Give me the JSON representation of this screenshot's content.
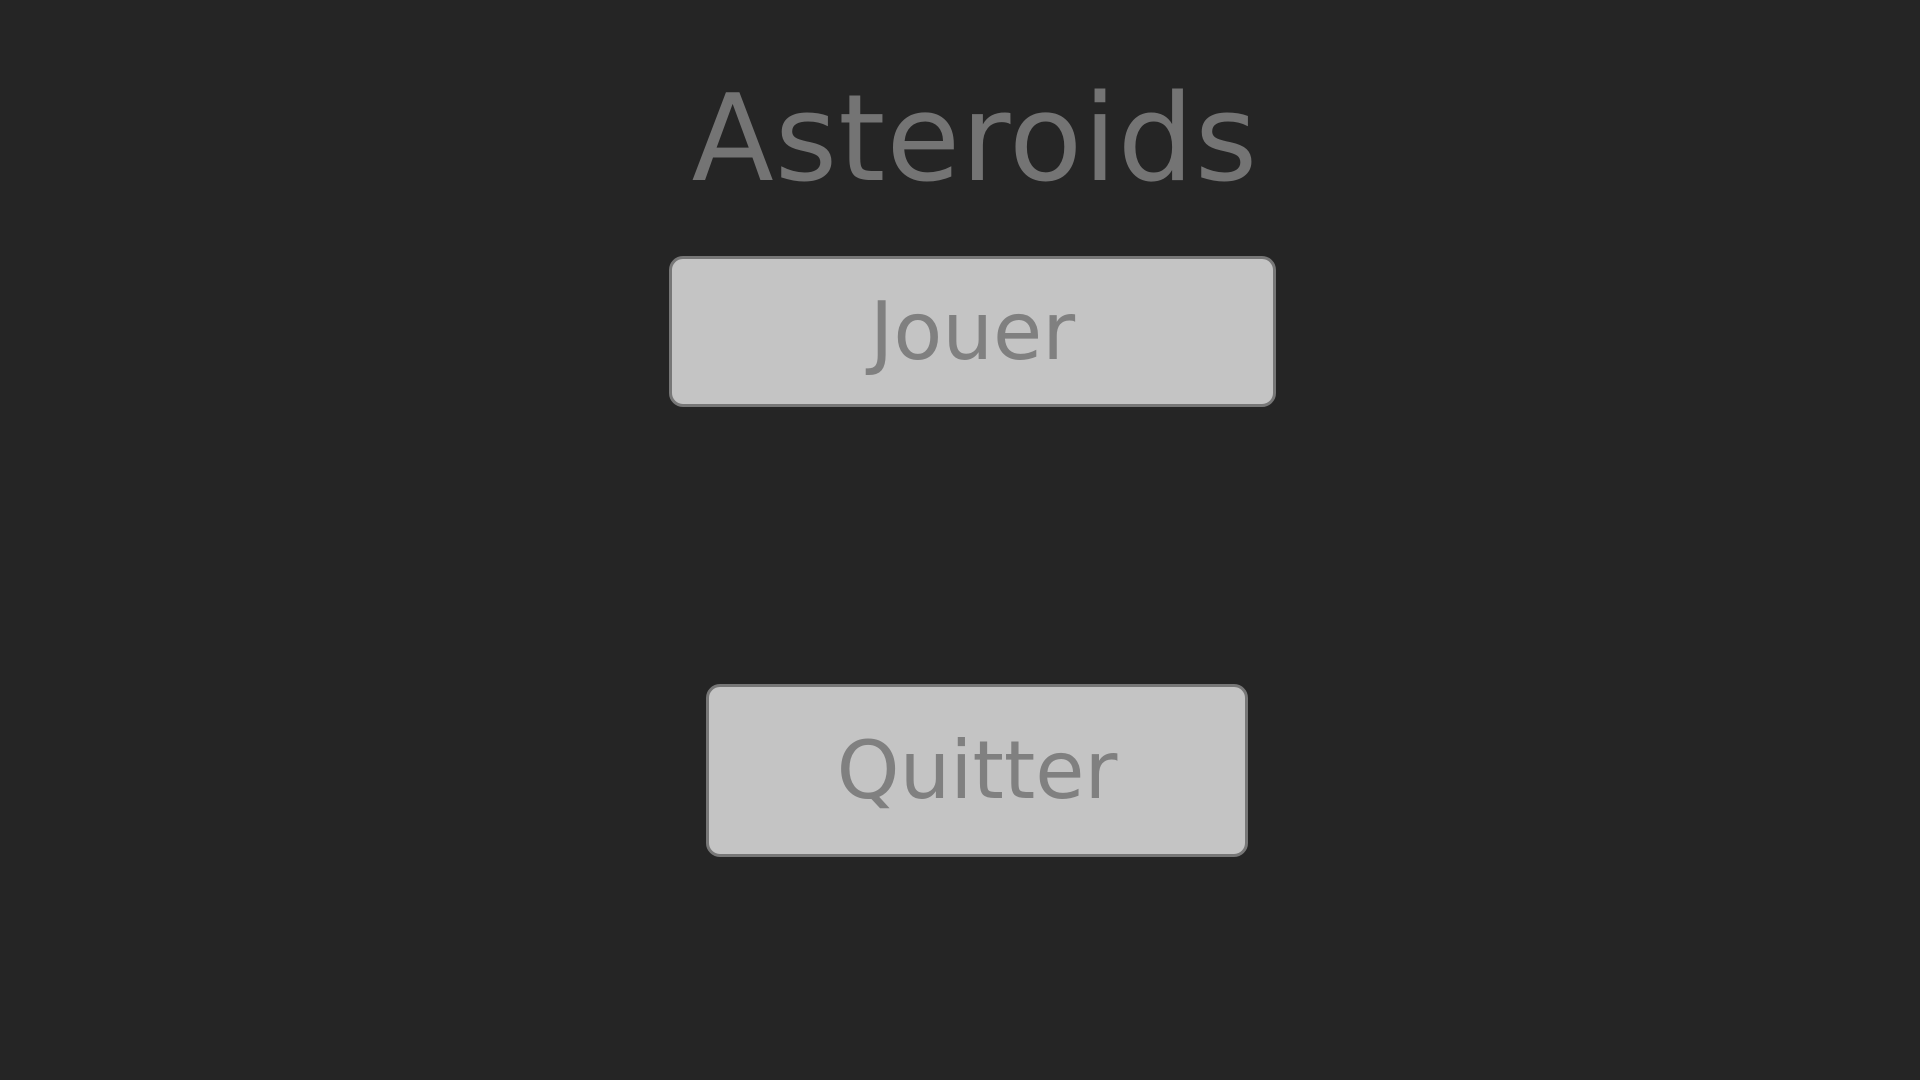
{
  "game": {
    "title": "Asteroids"
  },
  "menu": {
    "play_label": "Jouer",
    "quit_label": "Quitter"
  },
  "colors": {
    "background": "#252525",
    "title_text": "#747474",
    "button_fill": "#c4c4c4",
    "button_border": "#777777",
    "button_text": "#808080"
  }
}
